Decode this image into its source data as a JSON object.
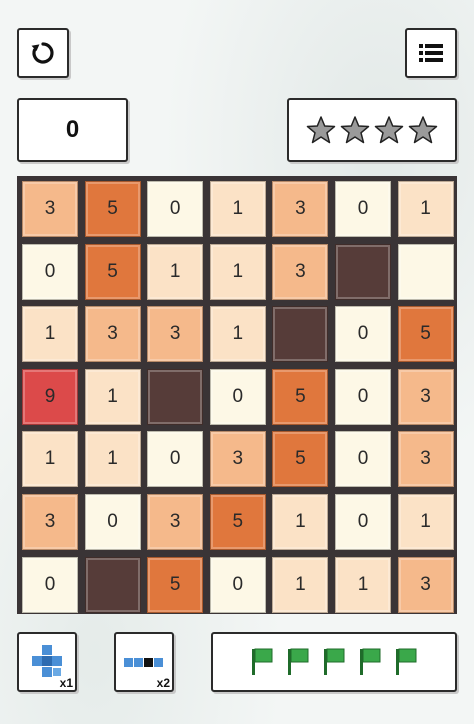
{
  "score": "0",
  "stars": {
    "total": 4,
    "earned": 0
  },
  "grid": {
    "rows": [
      [
        "3",
        "5",
        "0",
        "1",
        "3",
        "0",
        "1"
      ],
      [
        "0",
        "5",
        "1",
        "1",
        "3",
        "",
        ""
      ],
      [
        "1",
        "3",
        "3",
        "1",
        "",
        "0",
        "5"
      ],
      [
        "9",
        "1",
        "",
        "0",
        "5",
        "0",
        "3"
      ],
      [
        "1",
        "1",
        "0",
        "3",
        "5",
        "0",
        "3"
      ],
      [
        "3",
        "0",
        "3",
        "5",
        "1",
        "0",
        "1"
      ],
      [
        "0",
        "",
        "5",
        "0",
        "1",
        "1",
        "3"
      ]
    ],
    "blocked": [
      [
        1,
        5
      ],
      [
        2,
        4
      ],
      [
        3,
        2
      ],
      [
        6,
        1
      ]
    ],
    "colors": {
      "0": "#fdf8e6",
      "1": "#fbe2c6",
      "3": "#f5b98b",
      "5": "#e0773d",
      "9": "#dc4a4a",
      "blocked": "#563c39"
    }
  },
  "tools": {
    "area_bomb_count": "x1",
    "row_bomb_count": "x2"
  },
  "flags": {
    "count": 5,
    "color": "#3aa84a"
  }
}
